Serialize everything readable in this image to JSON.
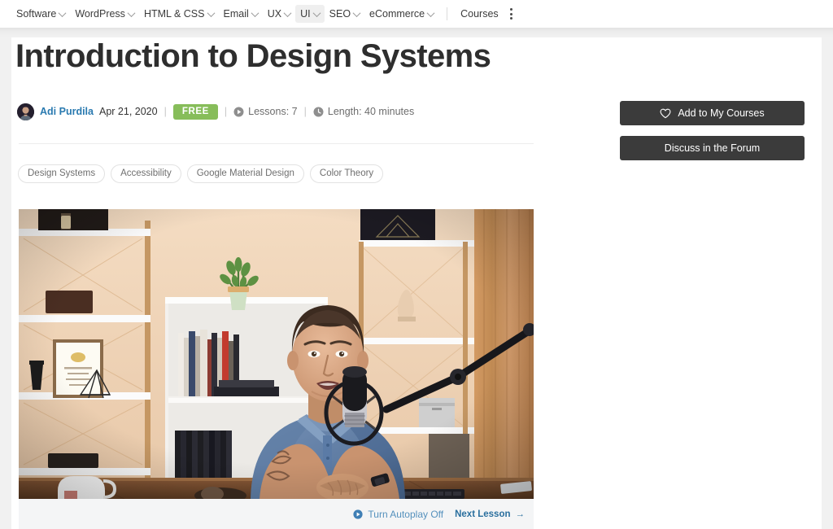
{
  "nav": {
    "items": [
      {
        "label": "Software",
        "caret": true,
        "active": false
      },
      {
        "label": "WordPress",
        "caret": true,
        "active": false
      },
      {
        "label": "HTML & CSS",
        "caret": true,
        "active": false
      },
      {
        "label": "Email",
        "caret": true,
        "active": false
      },
      {
        "label": "UX",
        "caret": true,
        "active": false
      },
      {
        "label": "UI",
        "caret": true,
        "active": true
      },
      {
        "label": "SEO",
        "caret": true,
        "active": false
      },
      {
        "label": "eCommerce",
        "caret": true,
        "active": false
      },
      {
        "label": "Courses",
        "caret": false,
        "active": false
      }
    ],
    "overflow_icon": "kebab-menu-icon"
  },
  "course": {
    "title": "Introduction to Design Systems",
    "author": "Adi Purdila",
    "date": "Apr 21, 2020",
    "price_badge": "FREE",
    "lessons_label": "Lessons: 7",
    "lessons_icon": "play-circle-icon",
    "length_label": "Length: 40 minutes",
    "length_icon": "clock-icon",
    "separator": "|"
  },
  "tags": [
    "Design Systems",
    "Accessibility",
    "Google Material Design",
    "Color Theory"
  ],
  "actions": {
    "add_to_courses": "Add to My Courses",
    "add_icon": "heart-outline-icon",
    "discuss": "Discuss in the Forum"
  },
  "video": {
    "autoplay_label": "Turn Autoplay Off",
    "autoplay_icon": "play-circle-icon",
    "next_lesson_label": "Next Lesson",
    "next_lesson_icon": "arrow-right-icon",
    "arrow_glyph": "→"
  },
  "colors": {
    "accent_blue": "#2a7ab0",
    "badge_green": "#87bd5a",
    "button_dark": "#3b3b3b",
    "footer_gray": "#f4f5f6",
    "page_bg": "#ffffff"
  }
}
